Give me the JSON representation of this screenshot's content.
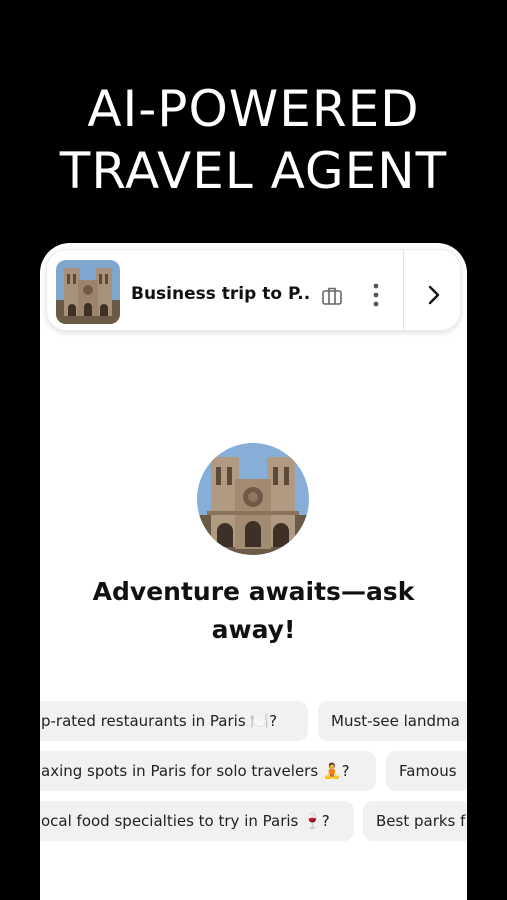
{
  "headline": {
    "line1": "AI-POWERED",
    "line2": "TRAVEL AGENT"
  },
  "header": {
    "trip_title": "Business trip to P...",
    "thumb_image": "notre-dame-cathedral",
    "briefcase_icon": "briefcase-icon",
    "more_icon": "more-vertical-icon",
    "next_icon": "chevron-right-icon"
  },
  "main": {
    "avatar_image": "notre-dame-cathedral",
    "prompt_title": "Adventure awaits—ask away!"
  },
  "suggestions": {
    "row1": [
      "p-rated restaurants in Paris 🍽️?",
      "Must-see landma"
    ],
    "row2": [
      "axing spots in Paris for solo travelers 🧘?",
      "Famous"
    ],
    "row3": [
      "ocal food specialties to try in Paris 🍷?",
      "Best parks f"
    ]
  },
  "colors": {
    "background": "#000000",
    "card": "#ffffff",
    "chip": "#f1f1f1",
    "text": "#111111"
  }
}
